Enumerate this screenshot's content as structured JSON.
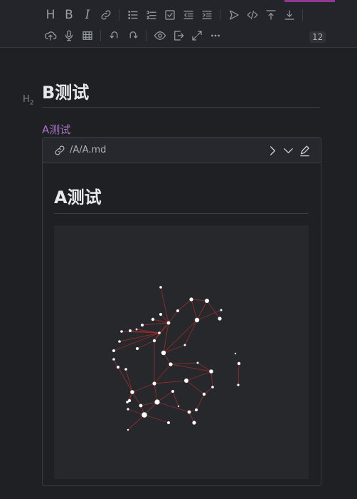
{
  "toolbar": {
    "row1": [
      {
        "name": "heading-icon",
        "kind": "text",
        "text": "H"
      },
      {
        "name": "bold-icon",
        "kind": "text",
        "text": "B"
      },
      {
        "name": "italic-icon",
        "kind": "text",
        "text": "I"
      },
      {
        "name": "link-icon",
        "kind": "svg"
      },
      {
        "name": "sep"
      },
      {
        "name": "bullet-list-icon",
        "kind": "svg"
      },
      {
        "name": "numbered-list-icon",
        "kind": "svg"
      },
      {
        "name": "checklist-icon",
        "kind": "svg"
      },
      {
        "name": "outdent-icon",
        "kind": "svg"
      },
      {
        "name": "indent-icon",
        "kind": "svg"
      },
      {
        "name": "sep"
      },
      {
        "name": "send-icon",
        "kind": "svg"
      },
      {
        "name": "code-icon",
        "kind": "svg"
      },
      {
        "name": "insert-before-icon",
        "kind": "svg"
      },
      {
        "name": "insert-after-icon",
        "kind": "svg"
      },
      {
        "name": "sep"
      }
    ],
    "row2": [
      {
        "name": "upload-icon",
        "kind": "svg"
      },
      {
        "name": "microphone-icon",
        "kind": "svg"
      },
      {
        "name": "table-icon",
        "kind": "svg"
      },
      {
        "name": "sep"
      },
      {
        "name": "undo-icon",
        "kind": "svg"
      },
      {
        "name": "redo-icon",
        "kind": "svg"
      },
      {
        "name": "sep"
      },
      {
        "name": "preview-eye-icon",
        "kind": "svg"
      },
      {
        "name": "export-icon",
        "kind": "svg"
      },
      {
        "name": "fullscreen-icon",
        "kind": "svg"
      },
      {
        "name": "more-icon",
        "kind": "svg"
      }
    ],
    "count_badge": "12",
    "accent_color": "#8f3a92"
  },
  "editor": {
    "heading_marker": "H",
    "heading_marker_sub": "2",
    "heading_b": "B测试",
    "embed_link": "A测试",
    "link_color": "#a873c7"
  },
  "embed": {
    "path": "/A/A.md",
    "heading": "A测试",
    "header_buttons": [
      "open-icon",
      "collapse-icon",
      "edit-icon"
    ]
  },
  "graph": {
    "node_color": "#ffffff",
    "edge_color": "#9c2d2d",
    "background": "#27282c"
  }
}
